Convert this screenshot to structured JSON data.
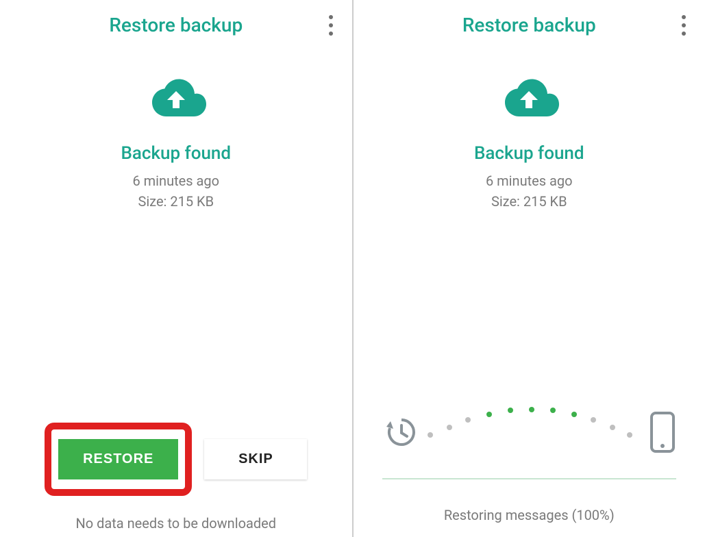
{
  "left": {
    "header": {
      "title": "Restore backup"
    },
    "backup": {
      "status": "Backup found",
      "time": "6 minutes ago",
      "size": "Size: 215 KB"
    },
    "buttons": {
      "restore": "RESTORE",
      "skip": "SKIP"
    },
    "footer": "No data needs to be downloaded"
  },
  "right": {
    "header": {
      "title": "Restore backup"
    },
    "backup": {
      "status": "Backup found",
      "time": "6 minutes ago",
      "size": "Size: 215 KB"
    },
    "progress": {
      "text": "Restoring messages (100%)",
      "percent": 100
    }
  },
  "colors": {
    "accent": "#1aa58e",
    "button": "#3cb04b",
    "highlight": "#e02020"
  }
}
